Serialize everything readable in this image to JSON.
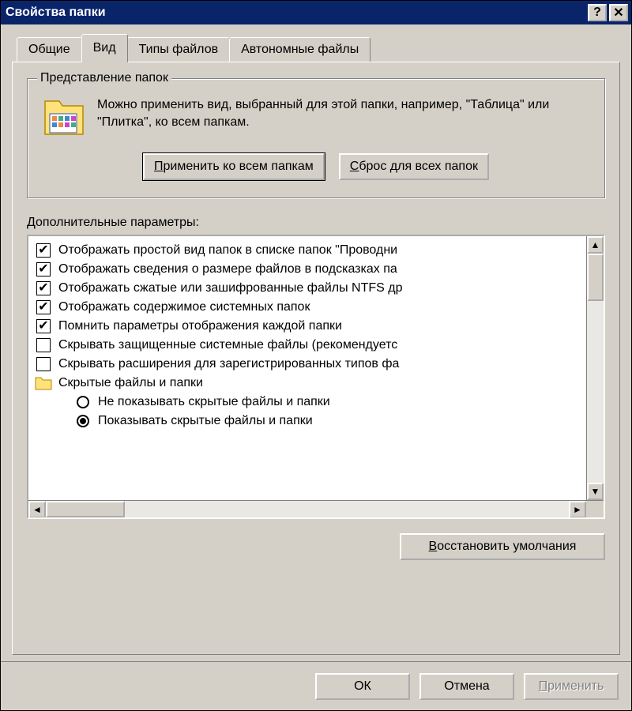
{
  "title": "Свойства папки",
  "tabs": [
    {
      "label": "Общие"
    },
    {
      "label": "Вид"
    },
    {
      "label": "Типы файлов"
    },
    {
      "label": "Автономные файлы"
    }
  ],
  "active_tab": 1,
  "group": {
    "legend": "Представление папок",
    "desc": "Можно применить вид, выбранный для этой папки, например, \"Таблица\" или \"Плитка\", ко всем папкам.",
    "apply_btn_u": "П",
    "apply_btn_rest": "рименить ко всем папкам",
    "reset_btn_u": "С",
    "reset_btn_rest": "брос для всех папок"
  },
  "adv_label": "Дополнительные параметры:",
  "items": [
    {
      "type": "checkbox",
      "checked": true,
      "label": "Отображать простой вид папок в списке папок \"Проводни"
    },
    {
      "type": "checkbox",
      "checked": true,
      "label": "Отображать сведения о размере файлов в подсказках па"
    },
    {
      "type": "checkbox",
      "checked": true,
      "label": "Отображать сжатые или зашифрованные файлы NTFS др"
    },
    {
      "type": "checkbox",
      "checked": true,
      "label": "Отображать содержимое системных папок"
    },
    {
      "type": "checkbox",
      "checked": true,
      "label": "Помнить параметры отображения каждой папки"
    },
    {
      "type": "checkbox",
      "checked": false,
      "label": "Скрывать защищенные системные файлы (рекомендуетс"
    },
    {
      "type": "checkbox",
      "checked": false,
      "label": "Скрывать расширения для зарегистрированных типов фа"
    },
    {
      "type": "folder",
      "label": "Скрытые файлы и папки"
    },
    {
      "type": "radio",
      "checked": false,
      "label": "Не показывать скрытые файлы и папки"
    },
    {
      "type": "radio",
      "checked": true,
      "label": "Показывать скрытые файлы и папки"
    }
  ],
  "restore_u": "В",
  "restore_rest": "осстановить умолчания",
  "footer": {
    "ok": "ОК",
    "cancel": "Отмена",
    "apply_u": "П",
    "apply_rest": "рименить"
  }
}
